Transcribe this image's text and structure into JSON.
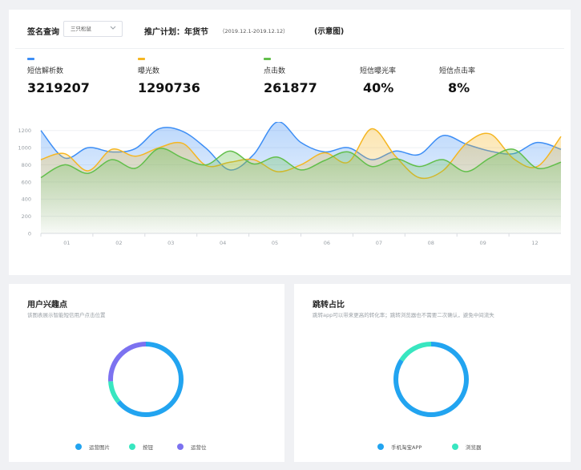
{
  "header": {
    "filter_label": "签名查询",
    "filter_value": "三只松鼠",
    "plan_label": "推广计划：年货节",
    "plan_dates": "（2019.12.1-2019.12.12）",
    "diagram_note": "(示意图)"
  },
  "metrics": [
    {
      "label": "短信解析数",
      "value": "3219207",
      "color": "#3d8ef5"
    },
    {
      "label": "曝光数",
      "value": "1290736",
      "color": "#f5b622"
    },
    {
      "label": "点击数",
      "value": "261877",
      "color": "#62bf4b"
    },
    {
      "label": "短信曝光率",
      "value": "40%"
    },
    {
      "label": "短信点击率",
      "value": "8%"
    }
  ],
  "chart_data": [
    {
      "type": "area",
      "x": [
        "01",
        "02",
        "03",
        "04",
        "05",
        "06",
        "07",
        "08",
        "09",
        "12"
      ],
      "ylim": [
        0,
        1300
      ],
      "yticks": [
        0,
        200,
        400,
        600,
        800,
        1000,
        1200
      ],
      "grid": true,
      "series": [
        {
          "name": "短信解析数",
          "color": "#3d8ef5",
          "values": [
            1200,
            880,
            1000,
            950,
            990,
            1220,
            1190,
            990,
            740,
            920,
            1300,
            1060,
            950,
            1000,
            860,
            960,
            920,
            1140,
            1040,
            960,
            930,
            1060,
            980
          ]
        },
        {
          "name": "曝光数",
          "color": "#f5b622",
          "values": [
            860,
            930,
            730,
            980,
            900,
            1000,
            1050,
            790,
            830,
            860,
            720,
            800,
            940,
            830,
            1220,
            900,
            650,
            730,
            1050,
            1160,
            870,
            780,
            1130
          ]
        },
        {
          "name": "点击数",
          "color": "#62bf4b",
          "values": [
            650,
            800,
            700,
            860,
            760,
            990,
            880,
            800,
            960,
            810,
            890,
            740,
            850,
            950,
            780,
            870,
            780,
            860,
            720,
            880,
            980,
            760,
            830
          ]
        }
      ]
    },
    {
      "type": "pie",
      "title": "用户兴趣点",
      "subtitle": "该图表展示智能短信用户点击位置",
      "labels": [
        "运营图片",
        "按钮",
        "运营位"
      ],
      "values": [
        64,
        10,
        26
      ],
      "colors": [
        "#22a4f0",
        "#38e6c0",
        "#7c72f0"
      ]
    },
    {
      "type": "pie",
      "title": "跳转占比",
      "subtitle": "跳转app可以带来更高的转化率；跳转浏览器也不需要二次确认，避免中间流失",
      "labels": [
        "手机淘宝APP",
        "浏览器"
      ],
      "values": [
        84,
        16
      ],
      "colors": [
        "#22a4f0",
        "#38e6c0"
      ]
    }
  ]
}
